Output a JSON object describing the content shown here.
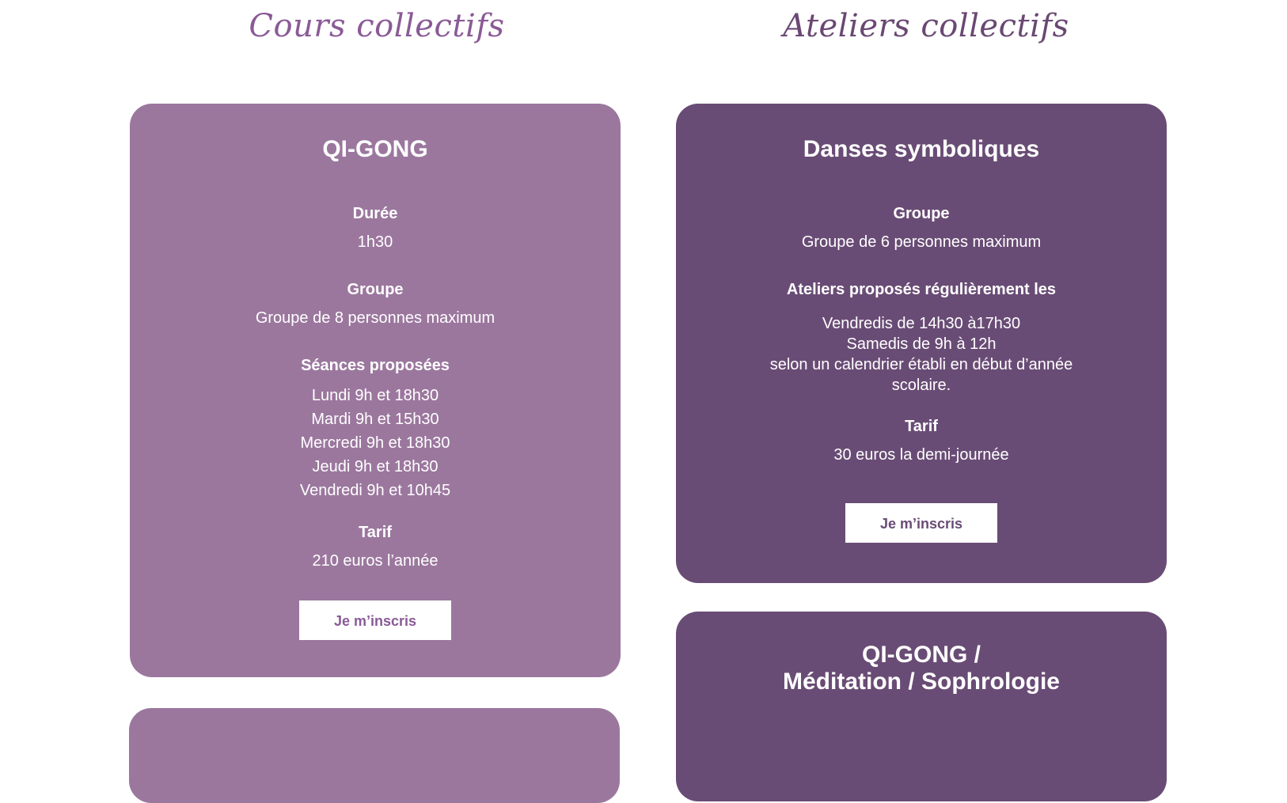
{
  "sections": {
    "left_title": "Cours collectifs",
    "right_title": "Ateliers collectifs"
  },
  "qigong_card": {
    "title": "QI-GONG",
    "duree_label": "Durée",
    "duree_value": "1h30",
    "groupe_label": "Groupe",
    "groupe_value": "Groupe de 8 personnes maximum",
    "seances_label": "Séances proposées",
    "seances": [
      "Lundi 9h et 18h30",
      "Mardi 9h et 15h30",
      "Mercredi 9h et 18h30",
      "Jeudi 9h et 18h30",
      "Vendredi 9h et 10h45"
    ],
    "tarif_label": "Tarif",
    "tarif_value": "210 euros l’année",
    "button_label": "Je m’inscris"
  },
  "danses_card": {
    "title": "Danses symboliques",
    "groupe_label": "Groupe",
    "groupe_value": "Groupe de 6 personnes maximum",
    "ateliers_label": "Ateliers proposés régulièrement les",
    "ateliers_lines": [
      "Vendredis de 14h30 à17h30",
      "Samedis de 9h à 12h",
      "selon un calendrier établi en début d’année",
      "scolaire."
    ],
    "tarif_label": "Tarif",
    "tarif_value": "30 euros la demi-journée",
    "button_label": "Je m’inscris"
  },
  "qigong_meditation_card": {
    "title_line1": "QI-GONG /",
    "title_line2": "Méditation / Sophrologie"
  },
  "colors": {
    "light_card": "#9b779e",
    "dark_card": "#694c75",
    "title_accent": "#8a5a96"
  }
}
